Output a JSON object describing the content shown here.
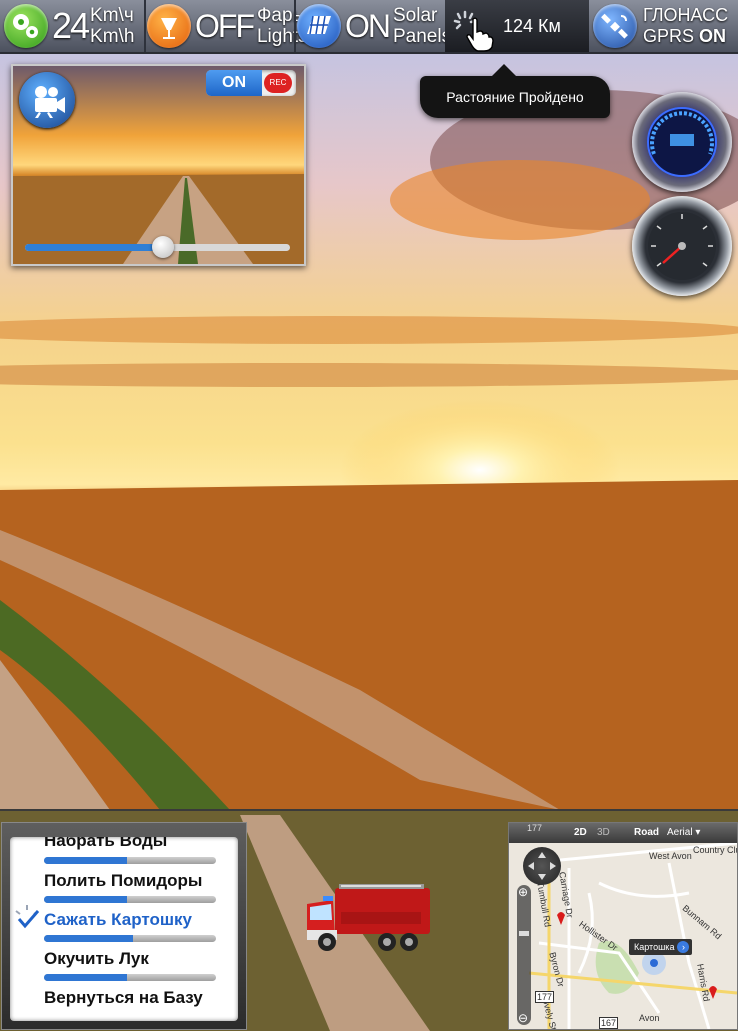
{
  "status_bar": {
    "speed": {
      "value": "24",
      "unit_top": "Km\\ч",
      "unit_bottom": "Km\\h"
    },
    "lights": {
      "state": "OFF",
      "label_ru": "Фары",
      "label_en": "Lights"
    },
    "solar": {
      "state": "ON",
      "label_top": "Solar",
      "label_bottom": "Panels"
    },
    "distance": {
      "value": "124 Км"
    },
    "gps": {
      "label": "ГЛОНАСС",
      "gprs_label": "GPRS",
      "gprs_state": "ON"
    }
  },
  "tooltip": {
    "text": "Растояние Пройдено"
  },
  "camera": {
    "toggle_label": "ON",
    "rec_label": "REC",
    "slider_level": 0.52
  },
  "menu": {
    "items": [
      {
        "label": "Набрать Воды",
        "progress": 0.48
      },
      {
        "label": "Полить Помидоры",
        "progress": 0.48
      },
      {
        "label": "Сажать Картошку",
        "progress": 0.52,
        "selected": true
      },
      {
        "label": "Окучить Лук",
        "progress": 0.48
      },
      {
        "label": "Вернуться на Базу",
        "progress": 0.0
      }
    ]
  },
  "map": {
    "view_2d": "2D",
    "view_3d": "3D",
    "road": "Road",
    "aerial": "Aerial",
    "callout": "Картошка",
    "labels": [
      "West Avon",
      "Country Club",
      "Tumbull Rd",
      "Hollister Dr",
      "Carriage Dr",
      "Bunnam Rd",
      "Byron Dr",
      "Harris Rd",
      "Lovely St",
      "Avon"
    ],
    "shields": [
      "177",
      "177",
      "167"
    ]
  }
}
